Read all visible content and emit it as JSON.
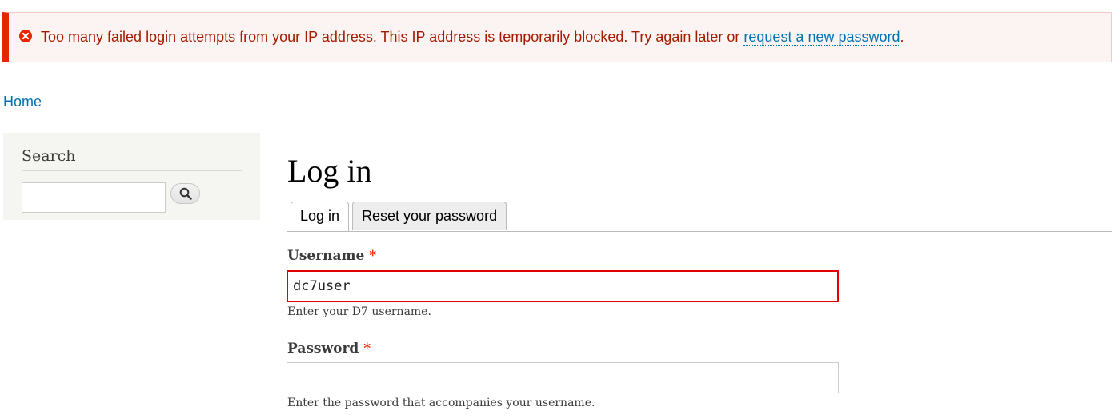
{
  "message": {
    "text": "Too many failed login attempts from your IP address. This IP address is temporarily blocked. Try again later or ",
    "link": "request a new password",
    "end": ".",
    "icon": "error-circle-icon"
  },
  "breadcrumb": {
    "home": "Home"
  },
  "sidebar": {
    "search_title": "Search",
    "search_value": "",
    "search_icon": "magnifier-icon"
  },
  "main": {
    "title": "Log in",
    "tabs": [
      {
        "label": "Log in",
        "active": true
      },
      {
        "label": "Reset your password",
        "active": false
      }
    ],
    "username": {
      "label": "Username",
      "required": "*",
      "value": "dc7user",
      "description": "Enter your D7 username."
    },
    "password": {
      "label": "Password",
      "required": "*",
      "value": "",
      "description": "Enter the password that accompanies your username."
    }
  },
  "colors": {
    "error_accent": "#e62600",
    "link": "#0071b3",
    "error_text": "#a51b00"
  }
}
